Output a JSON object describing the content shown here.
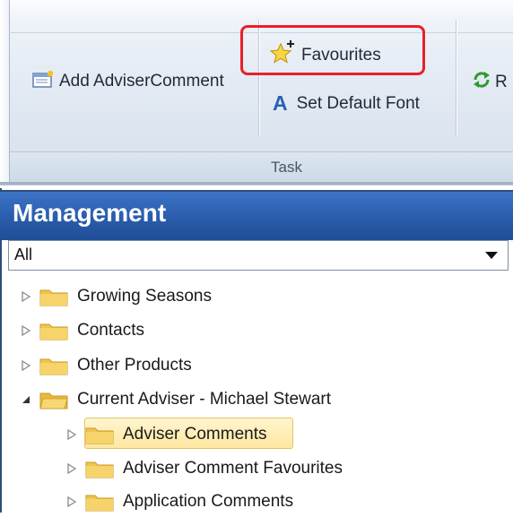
{
  "ribbon": {
    "add_adviser_comment": "Add AdviserComment",
    "favourites": "Favourites",
    "set_default_font": "Set Default Font",
    "refresh_partial": "R",
    "group_label": "Task"
  },
  "management": {
    "title": "Management",
    "filter_value": "All",
    "tree": [
      {
        "label": "Growing Seasons",
        "expanded": false,
        "level": 0
      },
      {
        "label": "Contacts",
        "expanded": false,
        "level": 0
      },
      {
        "label": "Other Products",
        "expanded": false,
        "level": 0
      },
      {
        "label": "Current Adviser - Michael Stewart",
        "expanded": true,
        "level": 0
      },
      {
        "label": "Adviser Comments",
        "expanded": false,
        "level": 1,
        "selected": true
      },
      {
        "label": "Adviser Comment Favourites",
        "expanded": false,
        "level": 1
      },
      {
        "label": "Application Comments",
        "expanded": false,
        "level": 1
      }
    ]
  },
  "colors": {
    "highlight_box": "#e8202a",
    "panel_header": "#2a5cab",
    "folder": "#f2c44f",
    "selection": "#ffe7a1"
  },
  "icons": [
    "add-comment-icon",
    "favourites-star-icon",
    "font-a-icon",
    "refresh-icon",
    "expand-arrow-icon",
    "folder-icon",
    "dropdown-arrow-icon"
  ]
}
